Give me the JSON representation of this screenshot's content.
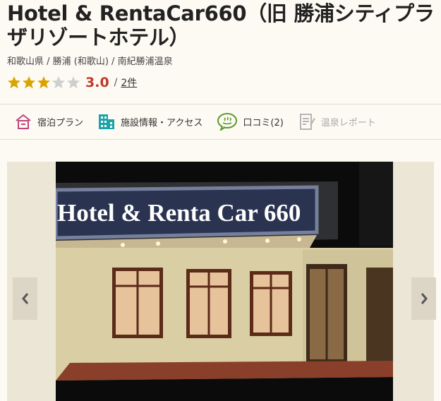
{
  "hotel": {
    "title": "Hotel & RentaCar660（旧 勝浦シティプラザリゾートホテル）",
    "breadcrumb": "和歌山県 / 勝浦 (和歌山) / 南紀勝浦温泉",
    "rating": {
      "stars": 3,
      "max": 5,
      "score": "3.0",
      "slash": "/",
      "review_count": "2件"
    }
  },
  "nav": {
    "items": [
      {
        "label": "宿泊プラン",
        "icon": "house-icon"
      },
      {
        "label": "施設情報・アクセス",
        "icon": "building-icon"
      },
      {
        "label": "口コミ(2)",
        "icon": "onsen-speech-icon"
      },
      {
        "label": "温泉レポート",
        "icon": "report-icon"
      }
    ]
  },
  "photo": {
    "sign_text": "Hotel & Renta Car 660"
  },
  "colors": {
    "accent_red": "#c0392b",
    "star_gold": "#d9a400",
    "star_gray": "#cfcfcf",
    "nav_pink": "#c0457a",
    "nav_teal": "#1aa3a8",
    "nav_green": "#5a9a2a"
  }
}
